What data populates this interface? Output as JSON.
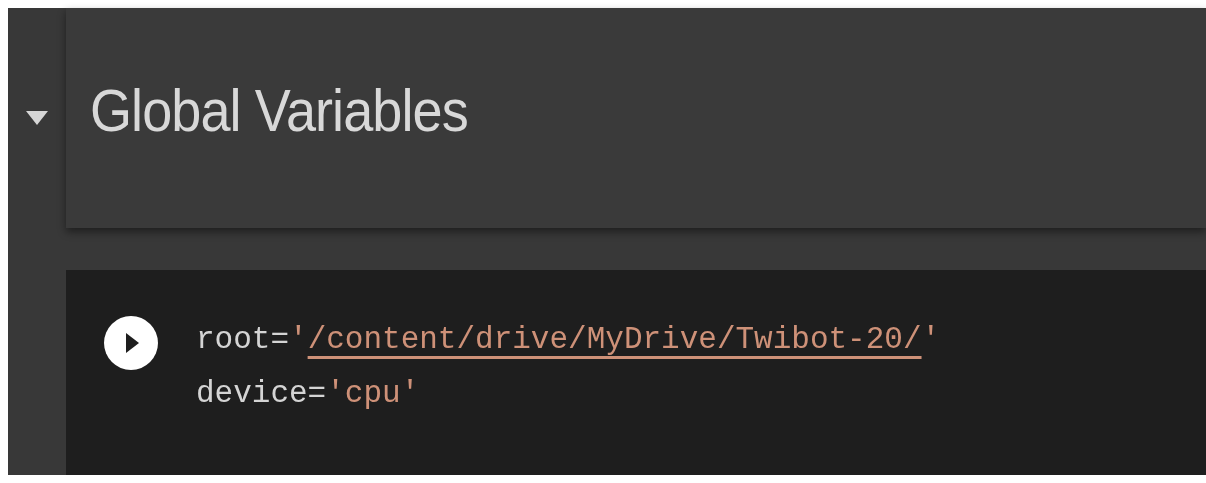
{
  "section": {
    "title": "Global Variables",
    "expanded": true
  },
  "code_cell": {
    "lines": [
      [
        {
          "text": "root=",
          "kind": "plain"
        },
        {
          "text": "'",
          "kind": "string"
        },
        {
          "text": "/content/drive/MyDrive/Twibot-20/",
          "kind": "link"
        },
        {
          "text": "'",
          "kind": "string"
        }
      ],
      [
        {
          "text": "device=",
          "kind": "plain"
        },
        {
          "text": "'cpu'",
          "kind": "string"
        }
      ]
    ]
  }
}
